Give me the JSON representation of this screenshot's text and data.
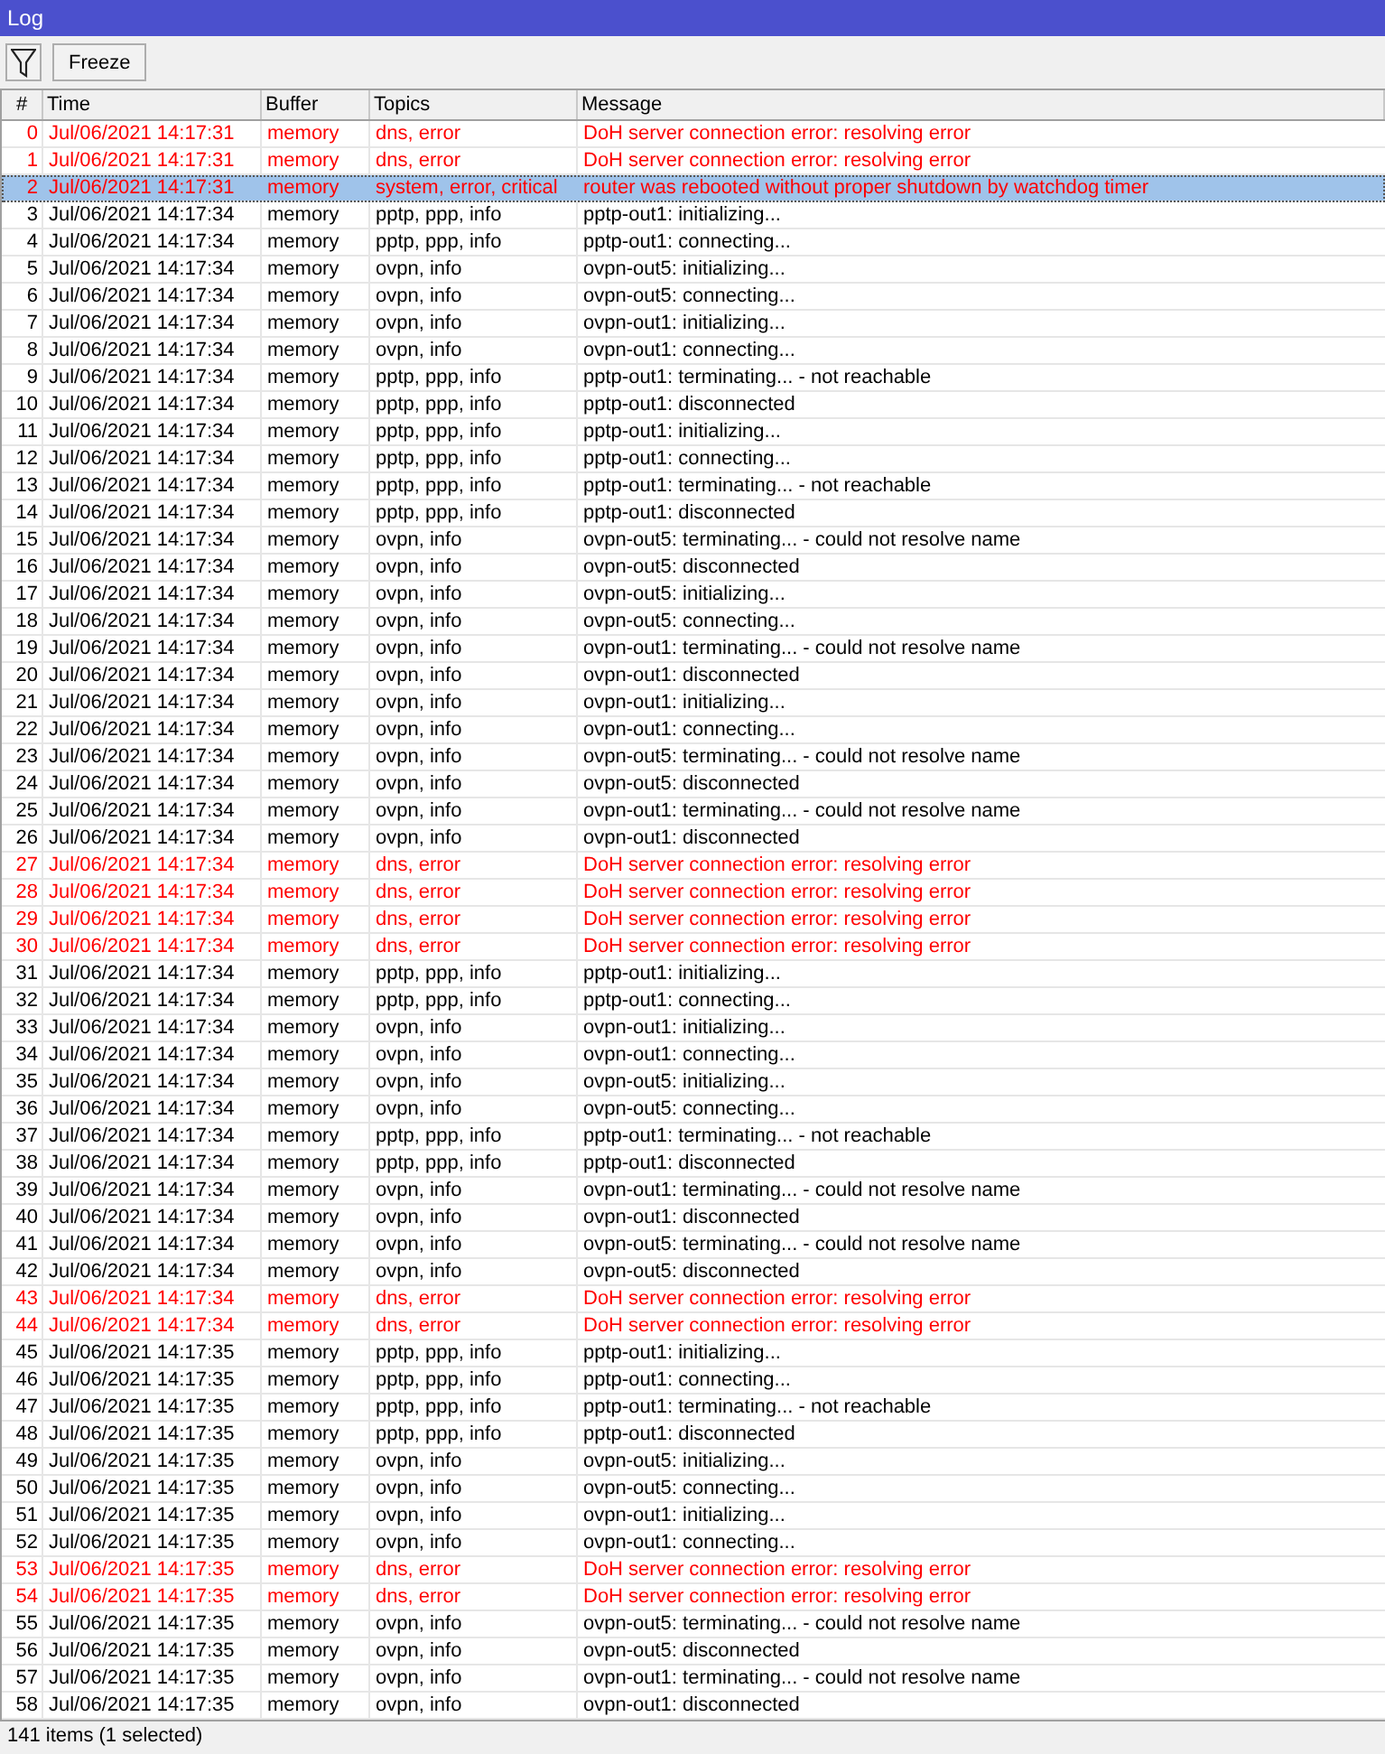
{
  "window": {
    "title": "Log"
  },
  "toolbar": {
    "buttons": [
      {
        "label": "Freeze"
      }
    ]
  },
  "table": {
    "columns": [
      "#",
      "Time",
      "Buffer",
      "Topics",
      "Message"
    ],
    "rows": [
      {
        "number": "0",
        "time": "Jul/06/2021 14:17:31",
        "buffer": "memory",
        "topics": "dns, error",
        "message": "DoH server connection error: resolving error",
        "kind": "error",
        "selected": false
      },
      {
        "number": "1",
        "time": "Jul/06/2021 14:17:31",
        "buffer": "memory",
        "topics": "dns, error",
        "message": "DoH server connection error: resolving error",
        "kind": "error",
        "selected": false
      },
      {
        "number": "2",
        "time": "Jul/06/2021 14:17:31",
        "buffer": "memory",
        "topics": "system, error, critical",
        "message": "router was rebooted without proper shutdown by watchdog timer",
        "kind": "error",
        "selected": true
      },
      {
        "number": "3",
        "time": "Jul/06/2021 14:17:34",
        "buffer": "memory",
        "topics": "pptp, ppp, info",
        "message": "pptp-out1: initializing...",
        "kind": "info",
        "selected": false
      },
      {
        "number": "4",
        "time": "Jul/06/2021 14:17:34",
        "buffer": "memory",
        "topics": "pptp, ppp, info",
        "message": "pptp-out1: connecting...",
        "kind": "info",
        "selected": false
      },
      {
        "number": "5",
        "time": "Jul/06/2021 14:17:34",
        "buffer": "memory",
        "topics": "ovpn, info",
        "message": "ovpn-out5: initializing...",
        "kind": "info",
        "selected": false
      },
      {
        "number": "6",
        "time": "Jul/06/2021 14:17:34",
        "buffer": "memory",
        "topics": "ovpn, info",
        "message": "ovpn-out5: connecting...",
        "kind": "info",
        "selected": false
      },
      {
        "number": "7",
        "time": "Jul/06/2021 14:17:34",
        "buffer": "memory",
        "topics": "ovpn, info",
        "message": "ovpn-out1: initializing...",
        "kind": "info",
        "selected": false
      },
      {
        "number": "8",
        "time": "Jul/06/2021 14:17:34",
        "buffer": "memory",
        "topics": "ovpn, info",
        "message": "ovpn-out1: connecting...",
        "kind": "info",
        "selected": false
      },
      {
        "number": "9",
        "time": "Jul/06/2021 14:17:34",
        "buffer": "memory",
        "topics": "pptp, ppp, info",
        "message": "pptp-out1: terminating... - not reachable",
        "kind": "info",
        "selected": false
      },
      {
        "number": "10",
        "time": "Jul/06/2021 14:17:34",
        "buffer": "memory",
        "topics": "pptp, ppp, info",
        "message": "pptp-out1: disconnected",
        "kind": "info",
        "selected": false
      },
      {
        "number": "11",
        "time": "Jul/06/2021 14:17:34",
        "buffer": "memory",
        "topics": "pptp, ppp, info",
        "message": "pptp-out1: initializing...",
        "kind": "info",
        "selected": false
      },
      {
        "number": "12",
        "time": "Jul/06/2021 14:17:34",
        "buffer": "memory",
        "topics": "pptp, ppp, info",
        "message": "pptp-out1: connecting...",
        "kind": "info",
        "selected": false
      },
      {
        "number": "13",
        "time": "Jul/06/2021 14:17:34",
        "buffer": "memory",
        "topics": "pptp, ppp, info",
        "message": "pptp-out1: terminating... - not reachable",
        "kind": "info",
        "selected": false
      },
      {
        "number": "14",
        "time": "Jul/06/2021 14:17:34",
        "buffer": "memory",
        "topics": "pptp, ppp, info",
        "message": "pptp-out1: disconnected",
        "kind": "info",
        "selected": false
      },
      {
        "number": "15",
        "time": "Jul/06/2021 14:17:34",
        "buffer": "memory",
        "topics": "ovpn, info",
        "message": "ovpn-out5: terminating... - could not resolve name",
        "kind": "info",
        "selected": false
      },
      {
        "number": "16",
        "time": "Jul/06/2021 14:17:34",
        "buffer": "memory",
        "topics": "ovpn, info",
        "message": "ovpn-out5: disconnected",
        "kind": "info",
        "selected": false
      },
      {
        "number": "17",
        "time": "Jul/06/2021 14:17:34",
        "buffer": "memory",
        "topics": "ovpn, info",
        "message": "ovpn-out5: initializing...",
        "kind": "info",
        "selected": false
      },
      {
        "number": "18",
        "time": "Jul/06/2021 14:17:34",
        "buffer": "memory",
        "topics": "ovpn, info",
        "message": "ovpn-out5: connecting...",
        "kind": "info",
        "selected": false
      },
      {
        "number": "19",
        "time": "Jul/06/2021 14:17:34",
        "buffer": "memory",
        "topics": "ovpn, info",
        "message": "ovpn-out1: terminating... - could not resolve name",
        "kind": "info",
        "selected": false
      },
      {
        "number": "20",
        "time": "Jul/06/2021 14:17:34",
        "buffer": "memory",
        "topics": "ovpn, info",
        "message": "ovpn-out1: disconnected",
        "kind": "info",
        "selected": false
      },
      {
        "number": "21",
        "time": "Jul/06/2021 14:17:34",
        "buffer": "memory",
        "topics": "ovpn, info",
        "message": "ovpn-out1: initializing...",
        "kind": "info",
        "selected": false
      },
      {
        "number": "22",
        "time": "Jul/06/2021 14:17:34",
        "buffer": "memory",
        "topics": "ovpn, info",
        "message": "ovpn-out1: connecting...",
        "kind": "info",
        "selected": false
      },
      {
        "number": "23",
        "time": "Jul/06/2021 14:17:34",
        "buffer": "memory",
        "topics": "ovpn, info",
        "message": "ovpn-out5: terminating... - could not resolve name",
        "kind": "info",
        "selected": false
      },
      {
        "number": "24",
        "time": "Jul/06/2021 14:17:34",
        "buffer": "memory",
        "topics": "ovpn, info",
        "message": "ovpn-out5: disconnected",
        "kind": "info",
        "selected": false
      },
      {
        "number": "25",
        "time": "Jul/06/2021 14:17:34",
        "buffer": "memory",
        "topics": "ovpn, info",
        "message": "ovpn-out1: terminating... - could not resolve name",
        "kind": "info",
        "selected": false
      },
      {
        "number": "26",
        "time": "Jul/06/2021 14:17:34",
        "buffer": "memory",
        "topics": "ovpn, info",
        "message": "ovpn-out1: disconnected",
        "kind": "info",
        "selected": false
      },
      {
        "number": "27",
        "time": "Jul/06/2021 14:17:34",
        "buffer": "memory",
        "topics": "dns, error",
        "message": "DoH server connection error: resolving error",
        "kind": "error",
        "selected": false
      },
      {
        "number": "28",
        "time": "Jul/06/2021 14:17:34",
        "buffer": "memory",
        "topics": "dns, error",
        "message": "DoH server connection error: resolving error",
        "kind": "error",
        "selected": false
      },
      {
        "number": "29",
        "time": "Jul/06/2021 14:17:34",
        "buffer": "memory",
        "topics": "dns, error",
        "message": "DoH server connection error: resolving error",
        "kind": "error",
        "selected": false
      },
      {
        "number": "30",
        "time": "Jul/06/2021 14:17:34",
        "buffer": "memory",
        "topics": "dns, error",
        "message": "DoH server connection error: resolving error",
        "kind": "error",
        "selected": false
      },
      {
        "number": "31",
        "time": "Jul/06/2021 14:17:34",
        "buffer": "memory",
        "topics": "pptp, ppp, info",
        "message": "pptp-out1: initializing...",
        "kind": "info",
        "selected": false
      },
      {
        "number": "32",
        "time": "Jul/06/2021 14:17:34",
        "buffer": "memory",
        "topics": "pptp, ppp, info",
        "message": "pptp-out1: connecting...",
        "kind": "info",
        "selected": false
      },
      {
        "number": "33",
        "time": "Jul/06/2021 14:17:34",
        "buffer": "memory",
        "topics": "ovpn, info",
        "message": "ovpn-out1: initializing...",
        "kind": "info",
        "selected": false
      },
      {
        "number": "34",
        "time": "Jul/06/2021 14:17:34",
        "buffer": "memory",
        "topics": "ovpn, info",
        "message": "ovpn-out1: connecting...",
        "kind": "info",
        "selected": false
      },
      {
        "number": "35",
        "time": "Jul/06/2021 14:17:34",
        "buffer": "memory",
        "topics": "ovpn, info",
        "message": "ovpn-out5: initializing...",
        "kind": "info",
        "selected": false
      },
      {
        "number": "36",
        "time": "Jul/06/2021 14:17:34",
        "buffer": "memory",
        "topics": "ovpn, info",
        "message": "ovpn-out5: connecting...",
        "kind": "info",
        "selected": false
      },
      {
        "number": "37",
        "time": "Jul/06/2021 14:17:34",
        "buffer": "memory",
        "topics": "pptp, ppp, info",
        "message": "pptp-out1: terminating... - not reachable",
        "kind": "info",
        "selected": false
      },
      {
        "number": "38",
        "time": "Jul/06/2021 14:17:34",
        "buffer": "memory",
        "topics": "pptp, ppp, info",
        "message": "pptp-out1: disconnected",
        "kind": "info",
        "selected": false
      },
      {
        "number": "39",
        "time": "Jul/06/2021 14:17:34",
        "buffer": "memory",
        "topics": "ovpn, info",
        "message": "ovpn-out1: terminating... - could not resolve name",
        "kind": "info",
        "selected": false
      },
      {
        "number": "40",
        "time": "Jul/06/2021 14:17:34",
        "buffer": "memory",
        "topics": "ovpn, info",
        "message": "ovpn-out1: disconnected",
        "kind": "info",
        "selected": false
      },
      {
        "number": "41",
        "time": "Jul/06/2021 14:17:34",
        "buffer": "memory",
        "topics": "ovpn, info",
        "message": "ovpn-out5: terminating... - could not resolve name",
        "kind": "info",
        "selected": false
      },
      {
        "number": "42",
        "time": "Jul/06/2021 14:17:34",
        "buffer": "memory",
        "topics": "ovpn, info",
        "message": "ovpn-out5: disconnected",
        "kind": "info",
        "selected": false
      },
      {
        "number": "43",
        "time": "Jul/06/2021 14:17:34",
        "buffer": "memory",
        "topics": "dns, error",
        "message": "DoH server connection error: resolving error",
        "kind": "error",
        "selected": false
      },
      {
        "number": "44",
        "time": "Jul/06/2021 14:17:34",
        "buffer": "memory",
        "topics": "dns, error",
        "message": "DoH server connection error: resolving error",
        "kind": "error",
        "selected": false
      },
      {
        "number": "45",
        "time": "Jul/06/2021 14:17:35",
        "buffer": "memory",
        "topics": "pptp, ppp, info",
        "message": "pptp-out1: initializing...",
        "kind": "info",
        "selected": false
      },
      {
        "number": "46",
        "time": "Jul/06/2021 14:17:35",
        "buffer": "memory",
        "topics": "pptp, ppp, info",
        "message": "pptp-out1: connecting...",
        "kind": "info",
        "selected": false
      },
      {
        "number": "47",
        "time": "Jul/06/2021 14:17:35",
        "buffer": "memory",
        "topics": "pptp, ppp, info",
        "message": "pptp-out1: terminating... - not reachable",
        "kind": "info",
        "selected": false
      },
      {
        "number": "48",
        "time": "Jul/06/2021 14:17:35",
        "buffer": "memory",
        "topics": "pptp, ppp, info",
        "message": "pptp-out1: disconnected",
        "kind": "info",
        "selected": false
      },
      {
        "number": "49",
        "time": "Jul/06/2021 14:17:35",
        "buffer": "memory",
        "topics": "ovpn, info",
        "message": "ovpn-out5: initializing...",
        "kind": "info",
        "selected": false
      },
      {
        "number": "50",
        "time": "Jul/06/2021 14:17:35",
        "buffer": "memory",
        "topics": "ovpn, info",
        "message": "ovpn-out5: connecting...",
        "kind": "info",
        "selected": false
      },
      {
        "number": "51",
        "time": "Jul/06/2021 14:17:35",
        "buffer": "memory",
        "topics": "ovpn, info",
        "message": "ovpn-out1: initializing...",
        "kind": "info",
        "selected": false
      },
      {
        "number": "52",
        "time": "Jul/06/2021 14:17:35",
        "buffer": "memory",
        "topics": "ovpn, info",
        "message": "ovpn-out1: connecting...",
        "kind": "info",
        "selected": false
      },
      {
        "number": "53",
        "time": "Jul/06/2021 14:17:35",
        "buffer": "memory",
        "topics": "dns, error",
        "message": "DoH server connection error: resolving error",
        "kind": "error",
        "selected": false
      },
      {
        "number": "54",
        "time": "Jul/06/2021 14:17:35",
        "buffer": "memory",
        "topics": "dns, error",
        "message": "DoH server connection error: resolving error",
        "kind": "error",
        "selected": false
      },
      {
        "number": "55",
        "time": "Jul/06/2021 14:17:35",
        "buffer": "memory",
        "topics": "ovpn, info",
        "message": "ovpn-out5: terminating... - could not resolve name",
        "kind": "info",
        "selected": false
      },
      {
        "number": "56",
        "time": "Jul/06/2021 14:17:35",
        "buffer": "memory",
        "topics": "ovpn, info",
        "message": "ovpn-out5: disconnected",
        "kind": "info",
        "selected": false
      },
      {
        "number": "57",
        "time": "Jul/06/2021 14:17:35",
        "buffer": "memory",
        "topics": "ovpn, info",
        "message": "ovpn-out1: terminating... - could not resolve name",
        "kind": "info",
        "selected": false
      },
      {
        "number": "58",
        "time": "Jul/06/2021 14:17:35",
        "buffer": "memory",
        "topics": "ovpn, info",
        "message": "ovpn-out1: disconnected",
        "kind": "info",
        "selected": false
      }
    ]
  },
  "status_bar": {
    "text": "141 items (1 selected)"
  }
}
